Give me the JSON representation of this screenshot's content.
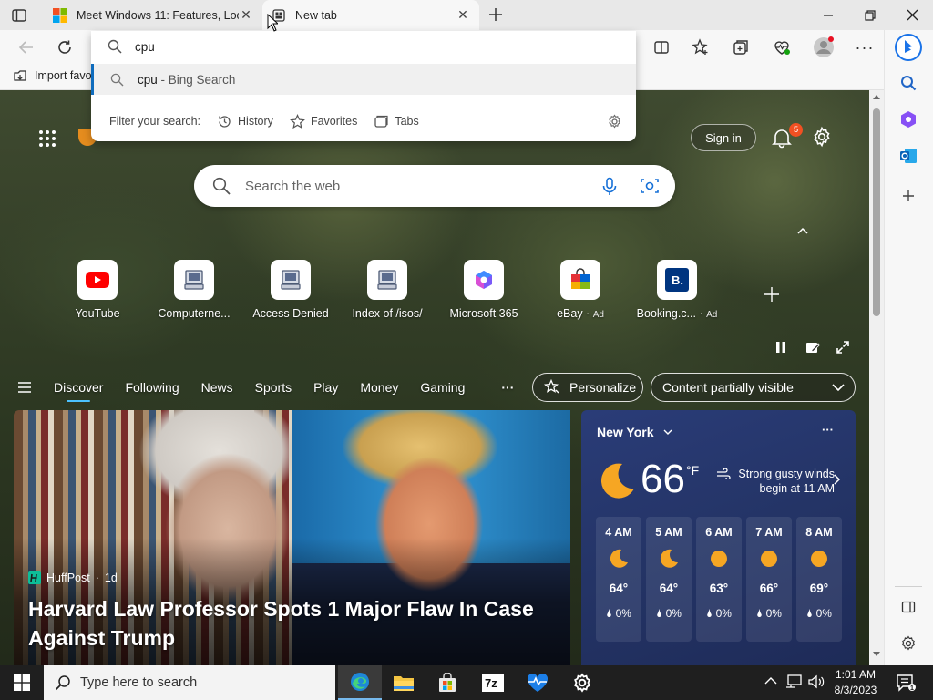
{
  "tabs": [
    {
      "title": "Meet Windows 11: Features, Loo"
    },
    {
      "title": "New tab"
    }
  ],
  "address": {
    "value": "cpu"
  },
  "suggestion": {
    "term": "cpu",
    "suffix": " - Bing Search"
  },
  "filter": {
    "label": "Filter your search:",
    "items": [
      "History",
      "Favorites",
      "Tabs"
    ]
  },
  "favorites_bar": {
    "import_label": "Import favo"
  },
  "newtab": {
    "sign_in": "Sign in",
    "notif_count": "5",
    "search_placeholder": "Search the web",
    "quick_links": [
      {
        "label": "YouTube",
        "ad": ""
      },
      {
        "label": "Computerne...",
        "ad": ""
      },
      {
        "label": "Access Denied",
        "ad": ""
      },
      {
        "label": "Index of /isos/",
        "ad": ""
      },
      {
        "label": "Microsoft 365",
        "ad": ""
      },
      {
        "label": "eBay",
        "ad": "Ad"
      },
      {
        "label": "Booking.c...",
        "ad": "Ad"
      }
    ],
    "nav": [
      "Discover",
      "Following",
      "News",
      "Sports",
      "Play",
      "Money",
      "Gaming"
    ],
    "personalize": "Personalize",
    "content_visibility": "Content partially visible"
  },
  "feed": {
    "source": "HuffPost",
    "age": "1d",
    "headline": "Harvard Law Professor Spots 1 Major Flaw In Case Against Trump"
  },
  "weather": {
    "location": "New York",
    "temp": "66",
    "unit": "°F",
    "alert_line1": "Strong gusty winds",
    "alert_line2": "begin at 11 AM",
    "hours": [
      {
        "time": "4 AM",
        "icon": "moon",
        "temp": "64°",
        "precip": "0%"
      },
      {
        "time": "5 AM",
        "icon": "moon",
        "temp": "64°",
        "precip": "0%"
      },
      {
        "time": "6 AM",
        "icon": "sun",
        "temp": "63°",
        "precip": "0%"
      },
      {
        "time": "7 AM",
        "icon": "sun",
        "temp": "66°",
        "precip": "0%"
      },
      {
        "time": "8 AM",
        "icon": "sun",
        "temp": "69°",
        "precip": "0%"
      }
    ]
  },
  "taskbar": {
    "search_placeholder": "Type here to search",
    "time": "1:01 AM",
    "date": "8/3/2023"
  },
  "colors": {
    "accent": "#0f6cbd",
    "weather_bg": "#243466",
    "nav_underline": "#4cc2ff",
    "badge": "#f25022"
  }
}
